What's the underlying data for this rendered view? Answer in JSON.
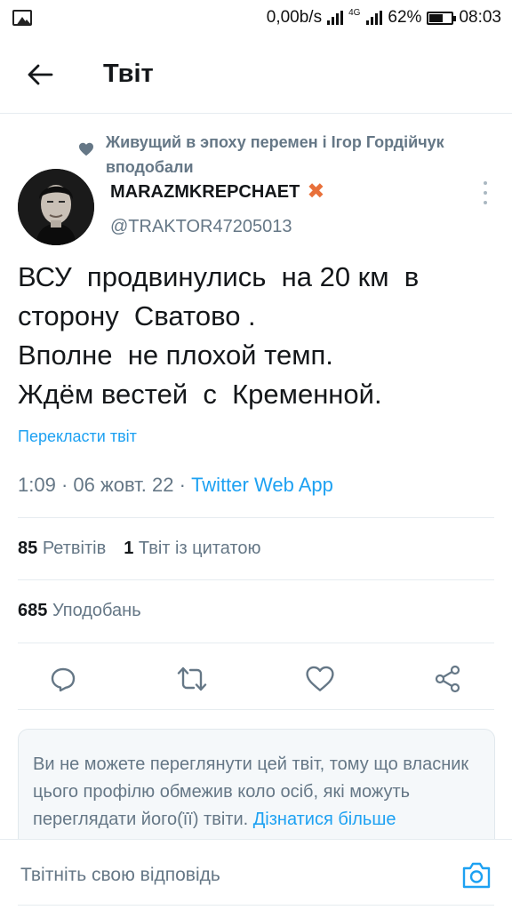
{
  "status_bar": {
    "speed": "0,00b/s",
    "network_type": "4G",
    "battery": "62%",
    "battery_level": 0.62,
    "time": "08:03"
  },
  "header": {
    "title": "Твіт"
  },
  "tweet": {
    "liked_by": "Живущий в эпоху перемен і Ігор Гордійчук вподобали",
    "author_name": "MARAZMKREPCHAET",
    "author_badge": "✖",
    "author_handle": "@TRAKTOR47205013",
    "text_lines": [
      "ВСУ  продвинулись  на 20 км  в",
      "сторону  Сватово .",
      "Вполне  не плохой темп.",
      "Ждём вестей  с  Кременной."
    ],
    "translate_label": "Перекласти твіт",
    "time": "1:09",
    "date": "06 жовт. 22",
    "source": "Twitter Web App",
    "retweets_count": "85",
    "retweets_label": "Ретвітів",
    "quotes_count": "1",
    "quotes_label": "Твіт із цитатою",
    "likes_count": "685",
    "likes_label": "Уподобань"
  },
  "actions": [
    {
      "icon": "reply-icon"
    },
    {
      "icon": "retweet-icon"
    },
    {
      "icon": "like-icon"
    },
    {
      "icon": "share-icon"
    }
  ],
  "notice": {
    "text": "Ви не можете переглянути цей твіт, тому що власник цього профілю обмежив коло осіб, які можуть переглядати його(її) твіти.",
    "more_label": "Дізнатися більше"
  },
  "reply": {
    "placeholder": "Твітніть свою відповідь"
  },
  "colors": {
    "accent": "#1da1f2",
    "secondary_text": "#657786",
    "badge": "#e8703a"
  }
}
